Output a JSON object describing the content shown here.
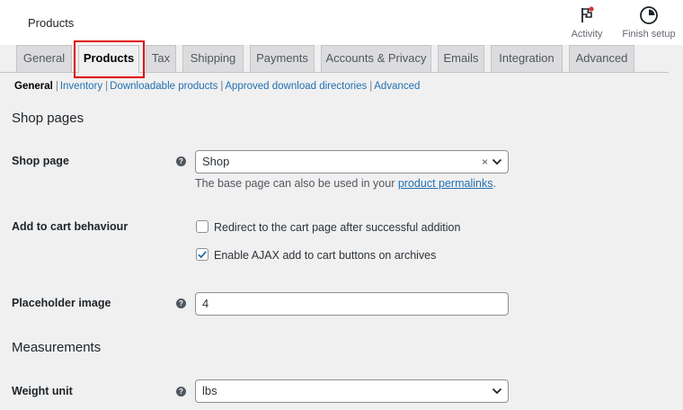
{
  "header": {
    "title": "Products",
    "activity_label": "Activity",
    "finish_setup_label": "Finish setup"
  },
  "tabs": [
    {
      "label": "General"
    },
    {
      "label": "Products",
      "active": true
    },
    {
      "label": "Tax"
    },
    {
      "label": "Shipping"
    },
    {
      "label": "Payments"
    },
    {
      "label": "Accounts & Privacy"
    },
    {
      "label": "Emails"
    },
    {
      "label": "Integration"
    },
    {
      "label": "Advanced"
    }
  ],
  "subnav": {
    "current": "General",
    "links": [
      "Inventory",
      "Downloadable products",
      "Approved download directories",
      "Advanced"
    ]
  },
  "shop_pages": {
    "heading": "Shop pages",
    "shop_page": {
      "label": "Shop page",
      "help": "?",
      "value": "Shop",
      "clear": "×",
      "desc_before": "The base page can also be used in your ",
      "desc_link": "product permalinks",
      "desc_after": "."
    },
    "add_to_cart": {
      "label": "Add to cart behaviour",
      "options": [
        {
          "label": "Redirect to the cart page after successful addition",
          "checked": false
        },
        {
          "label": "Enable AJAX add to cart buttons on archives",
          "checked": true
        }
      ]
    },
    "placeholder_image": {
      "label": "Placeholder image",
      "help": "?",
      "value": "4"
    }
  },
  "measurements": {
    "heading": "Measurements",
    "weight_unit": {
      "label": "Weight unit",
      "help": "?",
      "value": "lbs"
    }
  },
  "colors": {
    "accent": "#2271b1",
    "highlight": "#e00000",
    "notification": "#d63638"
  }
}
